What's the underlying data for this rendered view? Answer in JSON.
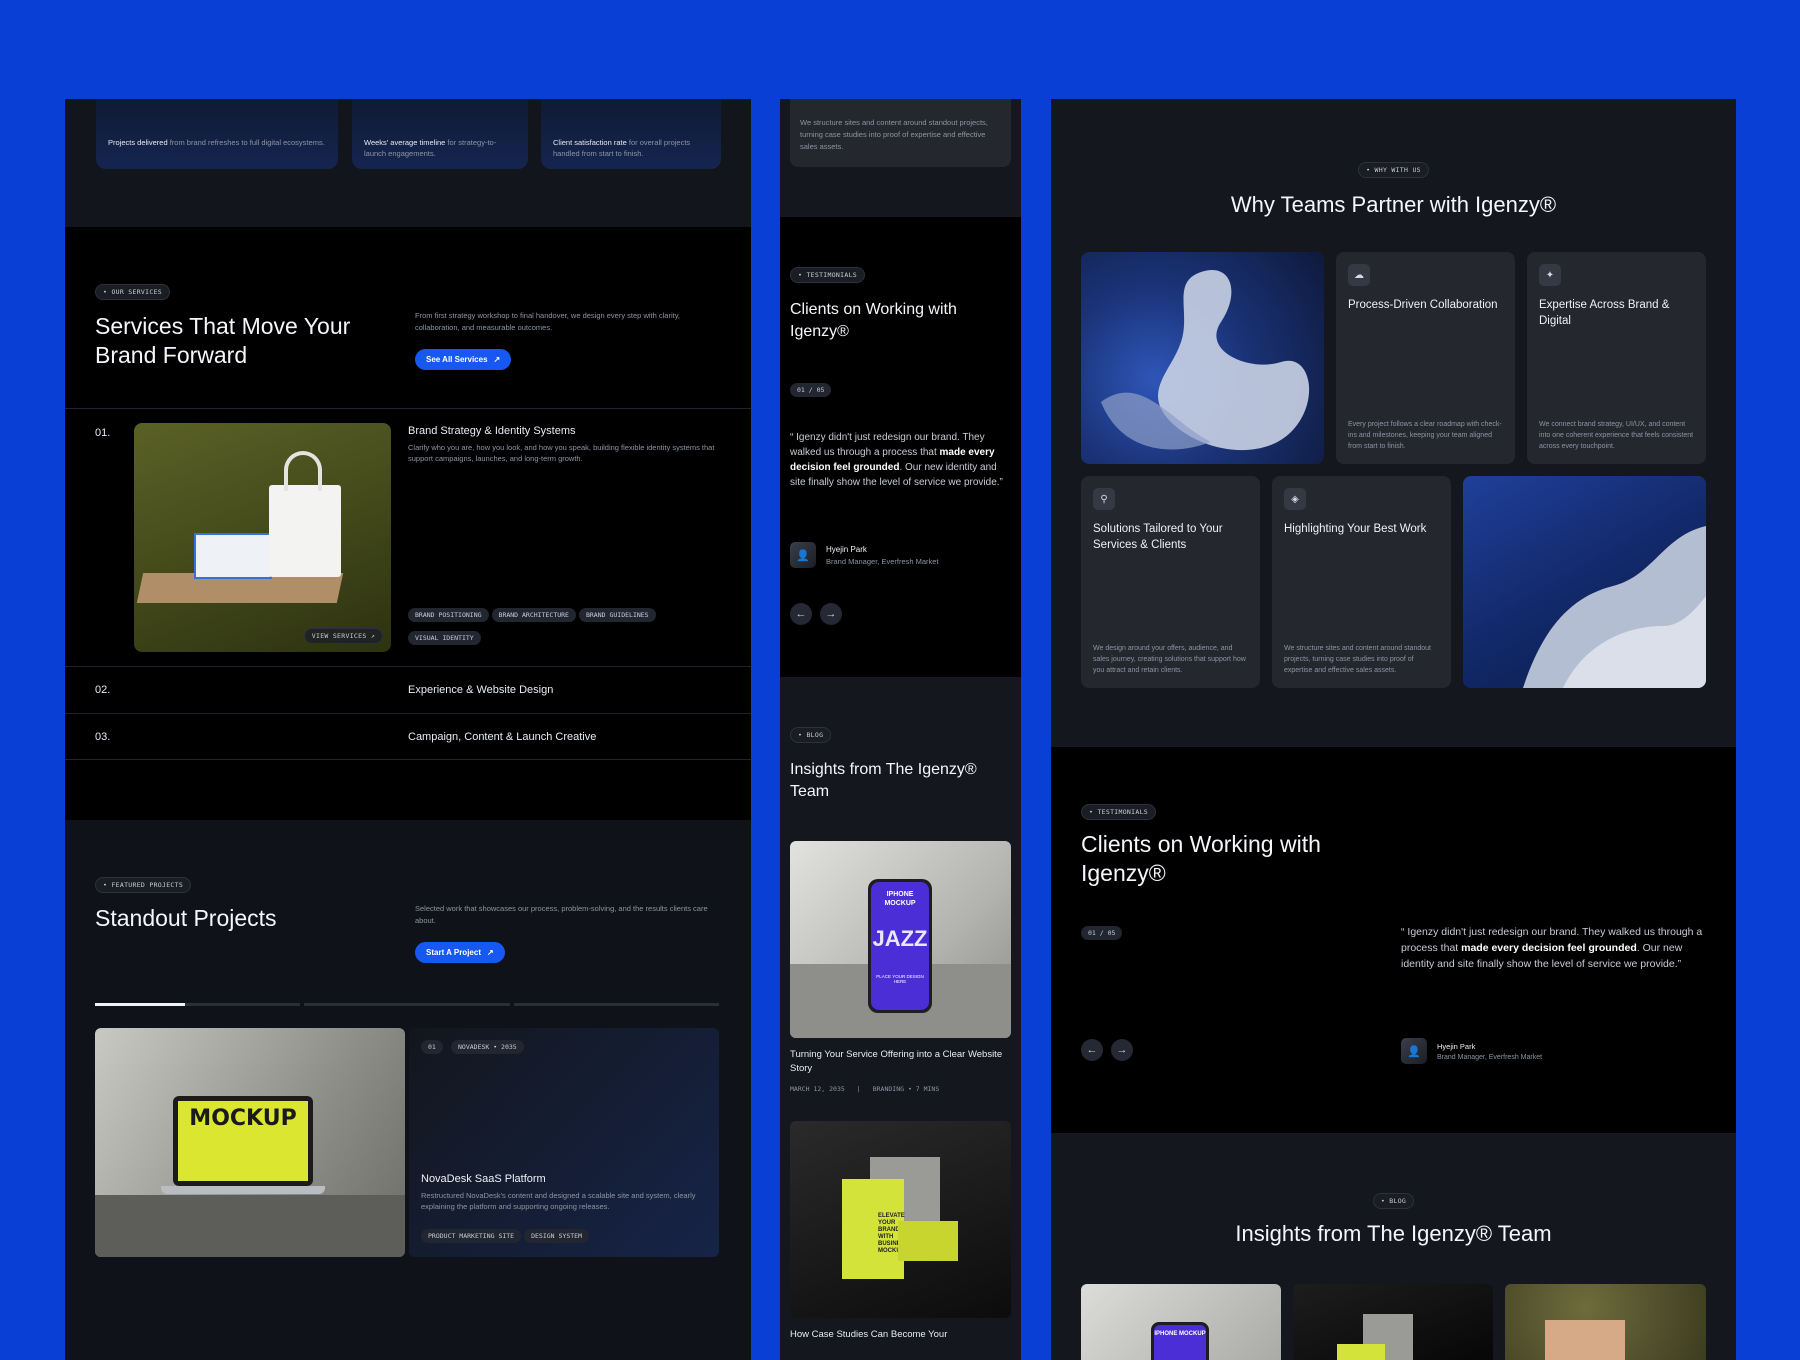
{
  "left": {
    "stats": [
      {
        "strong": "Projects delivered",
        "rest": " from brand refreshes to full digital ecosystems."
      },
      {
        "strong": "Weeks' average timeline",
        "rest": " for strategy-to-launch engagements."
      },
      {
        "strong": "Client satisfaction rate",
        "rest": " for overall projects handled from start to finish."
      }
    ],
    "services": {
      "tag": "OUR SERVICES",
      "title": "Services That Move Your Brand Forward",
      "desc": "From first strategy workshop to final handover, we design every step with clarity, collaboration, and measurable outcomes.",
      "button": "See All Services",
      "items": [
        {
          "num": "01.",
          "title": "Brand Strategy & Identity Systems",
          "desc": "Clarify who you are, how you look, and how you speak, building flexible identity systems that support campaigns, launches, and long-term growth.",
          "view": "VIEW SERVICES",
          "chips": [
            "BRAND POSITIONING",
            "BRAND ARCHITECTURE",
            "BRAND GUIDELINES",
            "VISUAL IDENTITY"
          ]
        },
        {
          "num": "02.",
          "title": "Experience & Website Design"
        },
        {
          "num": "03.",
          "title": "Campaign, Content & Launch Creative"
        }
      ]
    },
    "projects": {
      "tag": "FEATURED PROJECTS",
      "title": "Standout Projects",
      "desc": "Selected work that showcases our process, problem-solving, and the results clients care about.",
      "button": "Start A Project",
      "progress": 0.44,
      "card": {
        "index": "01",
        "meta": "NOVADESK • 2035",
        "title": "NovaDesk SaaS Platform",
        "desc": "Restructured NovaDesk's content and designed a scalable site and system, clearly explaining the platform and supporting ongoing releases.",
        "chips": [
          "PRODUCT MARKETING SITE",
          "DESIGN SYSTEM"
        ],
        "mock_text": "MOCKUP"
      }
    }
  },
  "mid": {
    "top_desc": "We structure sites and content around standout projects, turning case studies into proof of expertise and effective sales assets.",
    "testimonials": {
      "tag": "TESTIMONIALS",
      "title": "Clients on Working with Igenzy®",
      "counter": "01 / 05",
      "quote_open": "“ ",
      "quote_a": "Igenzy didn't just redesign our brand. They walked us through a process that ",
      "quote_b": "made every decision feel grounded",
      "quote_c": ". Our new identity and site finally show the level of service we provide.”",
      "name": "Hyejin Park",
      "role": "Brand Manager, Everfresh Market",
      "prev": "←",
      "next": "→"
    },
    "blog": {
      "tag": "BLOG",
      "title": "Insights from The Igenzy® Team",
      "post1": {
        "title": "Turning Your Service Offering into a Clear Website Story",
        "date": "MARCH 12, 2035",
        "meta": "BRANDING • 7 MINS",
        "phone_top": "IPHONE MOCKUP",
        "phone_big": "JAZZ",
        "phone_bottom": "PLACE YOUR DESIGN HERE"
      },
      "post2": {
        "title": "How Case Studies Can Become Your",
        "card_text": "ELEVATE YOUR BRAND WITH BUSINESS MOCKUPS"
      }
    }
  },
  "right": {
    "why": {
      "tag": "WHY WITH US",
      "title": "Why Teams Partner with Igenzy®",
      "cards": [
        {
          "title": "Process-Driven Collaboration",
          "desc": "Every project follows a clear roadmap with check-ins and milestones, keeping your team aligned from start to finish.",
          "icon": "cloud-icon"
        },
        {
          "title": "Expertise Across Brand & Digital",
          "desc": "We connect brand strategy, UI/UX, and content into one coherent experience that feels consistent across every touchpoint.",
          "icon": "sparkle-icon"
        },
        {
          "title": "Solutions Tailored to Your Services & Clients",
          "desc": "We design around your offers, audience, and sales journey, creating solutions that support how you attract and retain clients.",
          "icon": "pin-icon"
        },
        {
          "title": "Highlighting Your Best Work",
          "desc": "We structure sites and content around standout projects, turning case studies into proof of expertise and effective sales assets.",
          "icon": "layers-icon"
        }
      ]
    },
    "testimonials": {
      "tag": "TESTIMONIALS",
      "title": "Clients on Working with Igenzy®",
      "counter": "01 / 05",
      "quote_open": "“ ",
      "quote_a": "Igenzy didn't just redesign our brand. They walked us through a process that ",
      "quote_b": "made every decision feel grounded",
      "quote_c": ". Our new identity and site finally show the level of service we provide.”",
      "name": "Hyejin Park",
      "role": "Brand Manager, Everfresh Market",
      "prev": "←",
      "next": "→"
    },
    "blog": {
      "tag": "BLOG",
      "title": "Insights from The Igenzy® Team",
      "phone_top": "IPHONE MOCKUP"
    }
  },
  "colors": {
    "background": "#0a3fd6",
    "accent": "#1758f2",
    "panel": "#0d1016",
    "card": "#24272e"
  }
}
